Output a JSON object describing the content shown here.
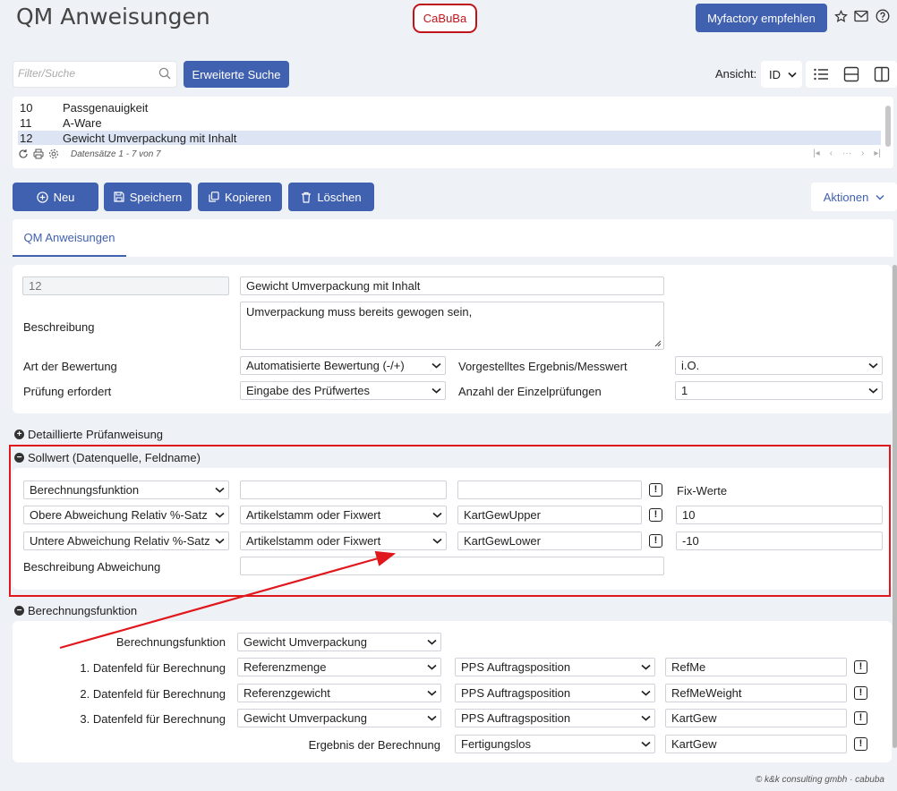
{
  "header": {
    "title": "QM Anweisungen",
    "brand": "CaBuBa",
    "recommend_label": "Myfactory empfehlen"
  },
  "search": {
    "placeholder": "Filter/Suche",
    "extended_label": "Erweiterte Suche",
    "view_label": "Ansicht:",
    "view_value": "ID"
  },
  "list": {
    "rows": [
      {
        "id": "10",
        "name": "Passgenauigkeit"
      },
      {
        "id": "11",
        "name": "A-Ware"
      },
      {
        "id": "12",
        "name": "Gewicht Umverpackung mit Inhalt"
      }
    ],
    "footer": "Datensätze 1 - 7 von 7",
    "pager_dots": "···"
  },
  "actions": {
    "new": "Neu",
    "save": "Speichern",
    "copy": "Kopieren",
    "delete": "Löschen",
    "more": "Aktionen"
  },
  "tabs": [
    {
      "label": "QM Anweisungen"
    }
  ],
  "form": {
    "id_value": "12",
    "name_value": "Gewicht Umverpackung mit Inhalt",
    "description_label": "Beschreibung",
    "description_value": "Umverpackung muss bereits gewogen sein,",
    "rating_label": "Art der Bewertung",
    "rating_value": "Automatisierte Bewertung (-/+)",
    "preset_label": "Vorgestelltes Ergebnis/Messwert",
    "preset_value": "i.O.",
    "check_label": "Prüfung erfordert",
    "check_value": "Eingabe des Prüfwertes",
    "count_label": "Anzahl der Einzelprüfungen",
    "count_value": "1"
  },
  "sections": {
    "detail": "Detaillierte Prüfanweisung",
    "sollwert": "Sollwert (Datenquelle, Feldname)",
    "berechnung": "Berechnungsfunktion"
  },
  "sollwert": {
    "row1_type": "Berechnungsfunktion",
    "row1_source": "",
    "row1_field": "",
    "fix_label": "Fix-Werte",
    "row2_type": "Obere Abweichung Relativ %-Satz",
    "row2_source": "Artikelstamm oder Fixwert",
    "row2_field": "KartGewUpper",
    "row2_fix": "10",
    "row3_type": "Untere Abweichung Relativ %-Satz",
    "row3_source": "Artikelstamm oder Fixwert",
    "row3_field": "KartGewLower",
    "row3_fix": "-10",
    "desc_label": "Beschreibung Abweichung",
    "desc_value": ""
  },
  "berechnung": {
    "func_label": "Berechnungsfunktion",
    "func_value": "Gewicht Umverpackung",
    "f1_label": "1. Datenfeld für Berechnung",
    "f1_a": "Referenzmenge",
    "f1_b": "PPS Auftragsposition",
    "f1_c": "RefMe",
    "f2_label": "2. Datenfeld für Berechnung",
    "f2_a": "Referenzgewicht",
    "f2_b": "PPS Auftragsposition",
    "f2_c": "RefMeWeight",
    "f3_label": "3. Datenfeld für Berechnung",
    "f3_a": "Gewicht Umverpackung",
    "f3_b": "PPS Auftragsposition",
    "f3_c": "KartGew",
    "result_label": "Ergebnis der Berechnung",
    "result_b": "Fertigungslos",
    "result_c": "KartGew"
  },
  "footer": {
    "copyright": "© k&k consulting gmbh · cabuba"
  },
  "colors": {
    "accent": "#4060b0",
    "annotation": "#e0181e"
  }
}
